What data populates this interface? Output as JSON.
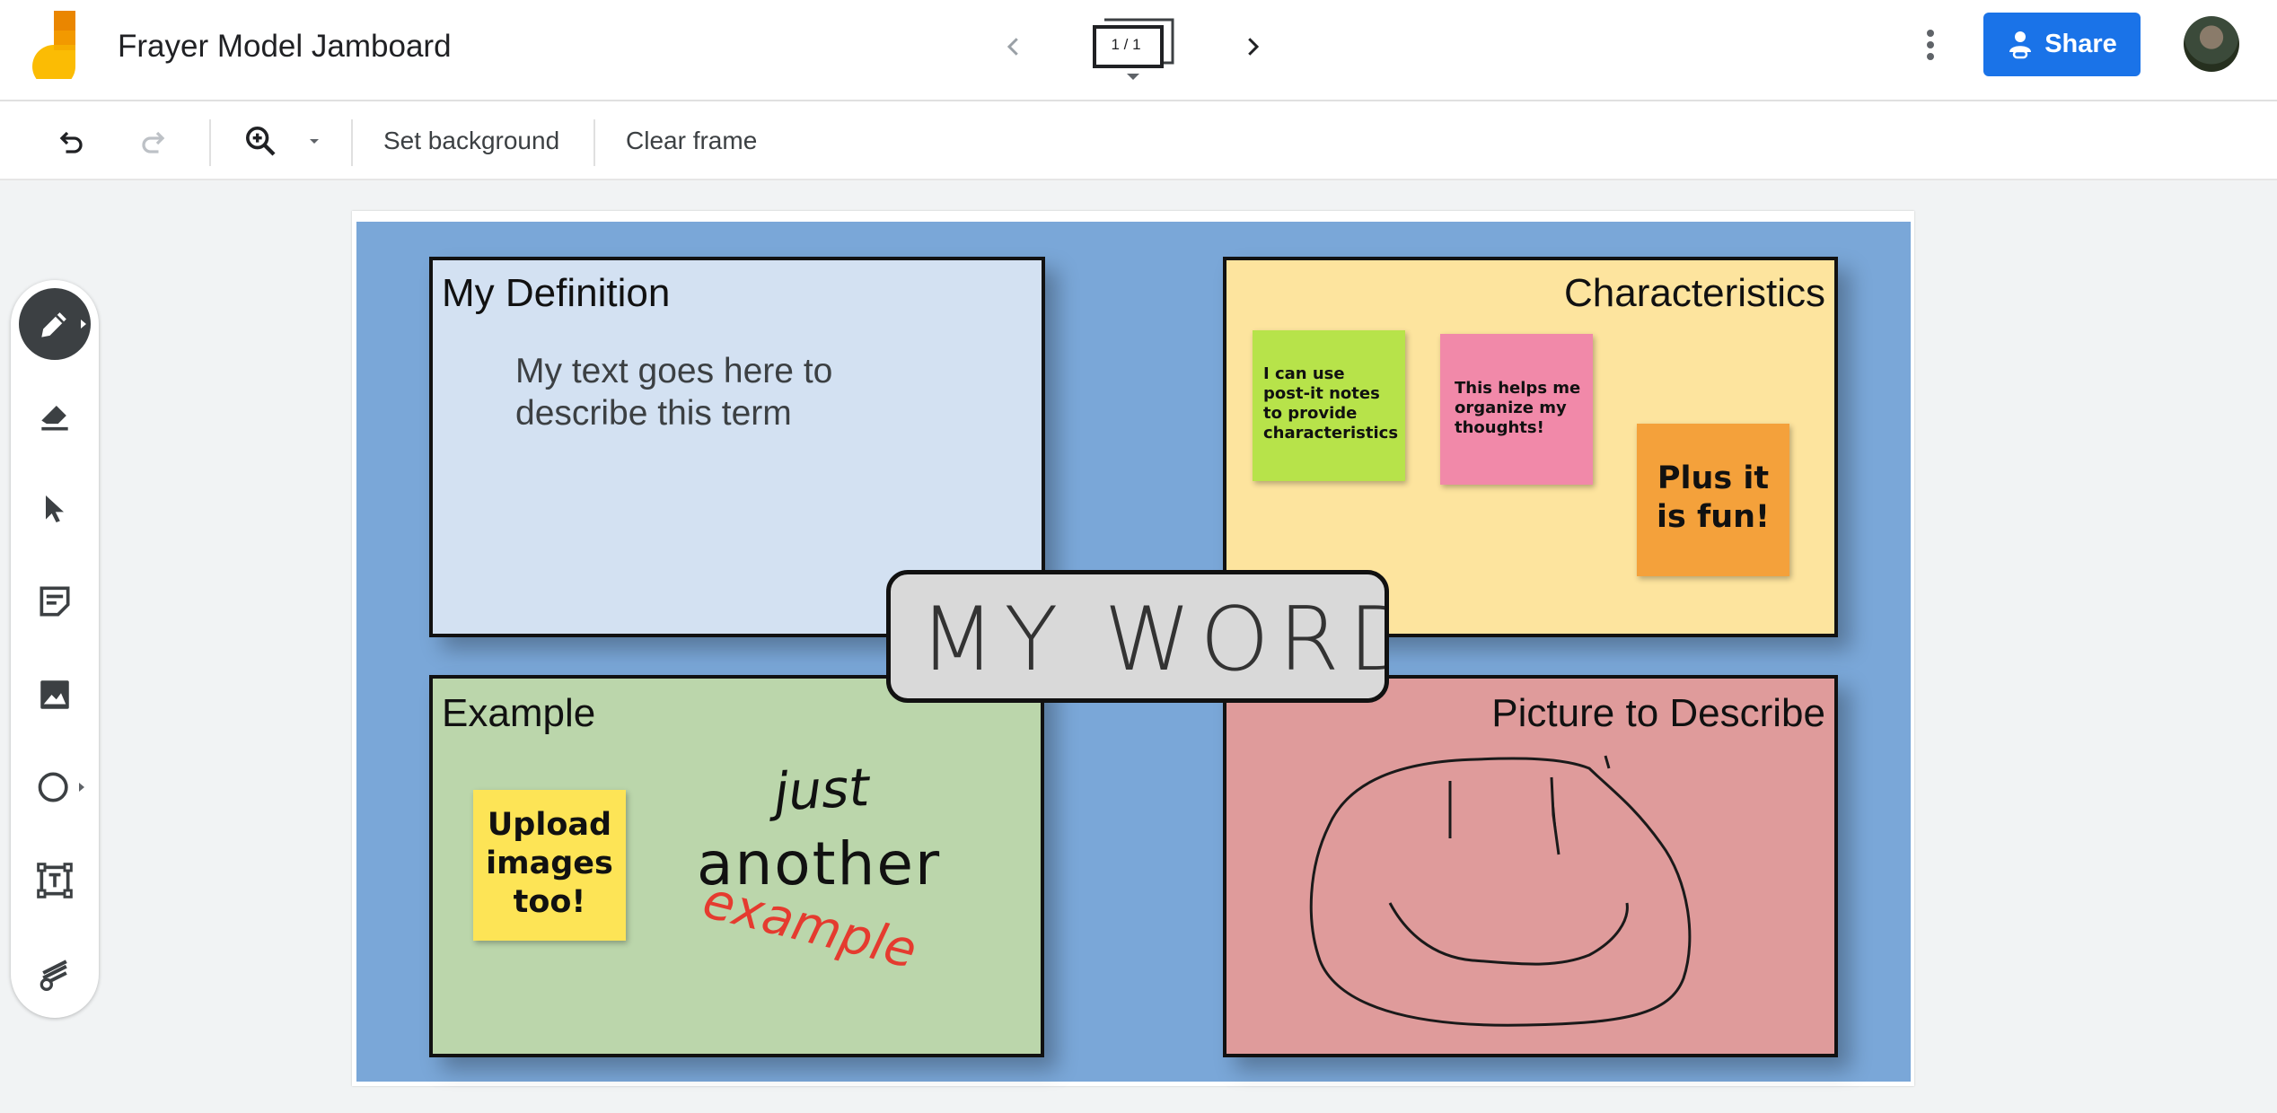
{
  "app": {
    "title": "Frayer Model Jamboard",
    "frame_indicator": "1 / 1",
    "share_label": "Share",
    "accent_color": "#1a73e8"
  },
  "toolbar": {
    "set_background_label": "Set background",
    "clear_frame_label": "Clear frame"
  },
  "tools": [
    "pen-icon",
    "eraser-icon",
    "select-icon",
    "sticky-note-icon",
    "image-icon",
    "circle-shape-icon",
    "text-box-icon",
    "laser-icon"
  ],
  "board": {
    "background_color": "#7aa7d8",
    "definition": {
      "title": "My Definition",
      "body_line1": "My text goes here to",
      "body_line2": "describe this term",
      "color": "#d3e1f2"
    },
    "characteristics": {
      "title": "Characteristics",
      "color": "#fde49e",
      "notes": [
        {
          "lines": [
            "I can use",
            "post-it notes",
            "to provide",
            "characteristics"
          ],
          "color": "#b7e34a"
        },
        {
          "lines": [
            "This helps me",
            "organize my",
            "thoughts!"
          ],
          "color": "#f189a9"
        },
        {
          "lines": [
            "Plus it",
            "is fun!"
          ],
          "color": "#f4a13b"
        }
      ]
    },
    "example": {
      "title": "Example",
      "color": "#bbd6ab",
      "note_lines": [
        "Upload",
        "images",
        "too!"
      ],
      "note_color": "#fde456",
      "hand_word1": "just",
      "hand_word2": "another",
      "hand_word3": "example"
    },
    "picture": {
      "title": "Picture to Describe",
      "color": "#df9b9b"
    },
    "center_word": "MY WORD"
  }
}
